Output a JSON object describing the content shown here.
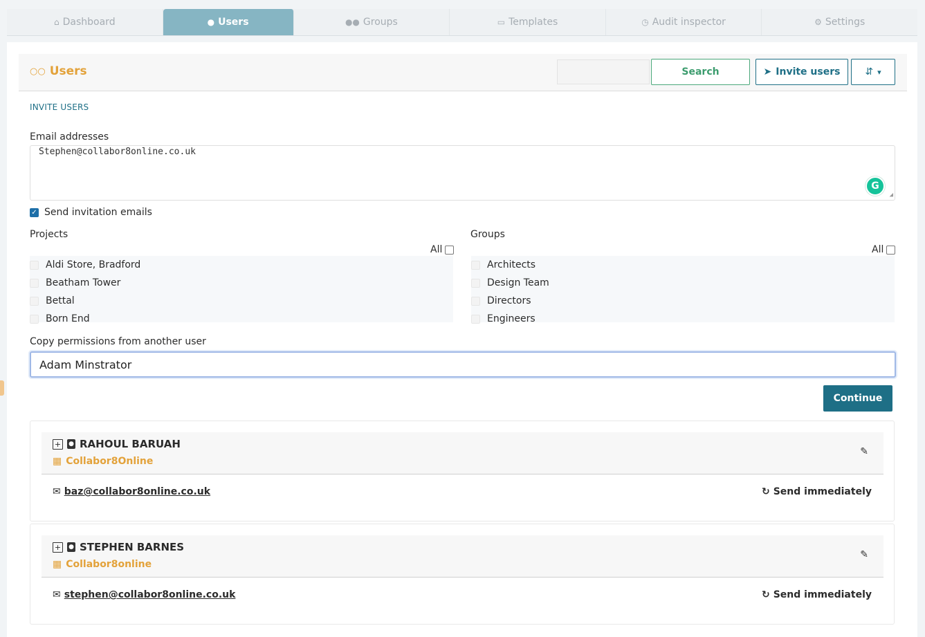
{
  "tabs": [
    {
      "label": "Dashboard",
      "icon": "home-icon",
      "glyph": "⌂"
    },
    {
      "label": "Users",
      "icon": "user-icon",
      "glyph": "👤"
    },
    {
      "label": "Groups",
      "icon": "groups-icon",
      "glyph": "👥"
    },
    {
      "label": "Templates",
      "icon": "folder-icon",
      "glyph": "▭"
    },
    {
      "label": "Audit inspector",
      "icon": "clock-icon",
      "glyph": "◷"
    },
    {
      "label": "Settings",
      "icon": "gear-icon",
      "glyph": "⚙"
    }
  ],
  "active_tab": "Users",
  "header": {
    "title": "Users",
    "search_button": "Search",
    "search_value": "",
    "invite_button": "Invite users",
    "sort_glyph": "⇵",
    "caret": "▾"
  },
  "form": {
    "section_label": "INVITE USERS",
    "email_label": "Email addresses",
    "email_value": "Stephen@collabor8online.co.uk",
    "grammarly_letter": "G",
    "send_invitation_label": "Send invitation emails",
    "send_invitation_checked": true,
    "projects_label": "Projects",
    "groups_label": "Groups",
    "all_label": "All",
    "projects": [
      "Aldi Store, Bradford",
      "Beatham Tower",
      "Bettal",
      "Born End"
    ],
    "groups": [
      "Architects",
      "Design Team",
      "Directors",
      "Engineers"
    ],
    "copy_label": "Copy permissions from another user",
    "copy_value": "Adam Minstrator",
    "continue_button": "Continue"
  },
  "users": [
    {
      "name": "RAHOUL BARUAH",
      "organisation": "Collabor8Online",
      "email": "baz@collabor8online.co.uk",
      "send_status": "Send immediately"
    },
    {
      "name": "STEPHEN BARNES",
      "organisation": "Collabor8online",
      "email": "stephen@collabor8online.co.uk",
      "send_status": "Send immediately"
    }
  ],
  "colors": {
    "accent": "#1e6f86",
    "active_tab": "#86b5c3",
    "orange": "#e3a23a",
    "search_green": "#3c9c6e"
  }
}
